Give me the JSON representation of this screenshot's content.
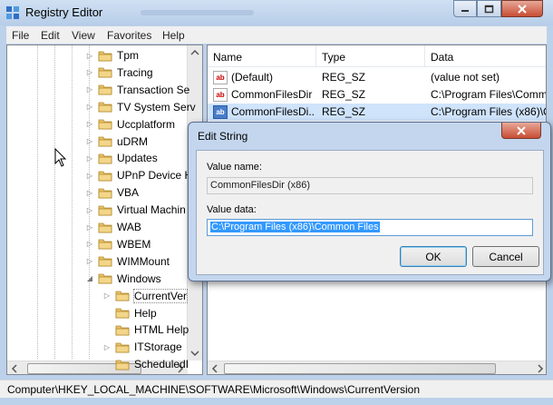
{
  "window": {
    "title": "Registry Editor",
    "controls": {
      "minimize": "minimize",
      "maximize": "maximize",
      "close": "close"
    }
  },
  "menu": [
    "File",
    "Edit",
    "View",
    "Favorites",
    "Help"
  ],
  "tree": {
    "items": [
      {
        "label": "Tpm",
        "expandable": true
      },
      {
        "label": "Tracing",
        "expandable": true
      },
      {
        "label": "Transaction Se",
        "expandable": true
      },
      {
        "label": "TV System Serv",
        "expandable": true
      },
      {
        "label": "Uccplatform",
        "expandable": true
      },
      {
        "label": "uDRM",
        "expandable": true
      },
      {
        "label": "Updates",
        "expandable": true
      },
      {
        "label": "UPnP Device H",
        "expandable": true
      },
      {
        "label": "VBA",
        "expandable": true
      },
      {
        "label": "Virtual Machin",
        "expandable": true
      },
      {
        "label": "WAB",
        "expandable": true
      },
      {
        "label": "WBEM",
        "expandable": true
      },
      {
        "label": "WIMMount",
        "expandable": true
      },
      {
        "label": "Windows",
        "expandable": true,
        "expanded": true
      },
      {
        "label": "CurrentVer",
        "expandable": true,
        "selected": true,
        "child": true
      },
      {
        "label": "Help",
        "expandable": false,
        "child": true
      },
      {
        "label": "HTML Help",
        "expandable": false,
        "child": true
      },
      {
        "label": "ITStorage",
        "expandable": true,
        "child": true
      },
      {
        "label": "ScheduledI",
        "expandable": false,
        "child": true
      }
    ]
  },
  "list": {
    "columns": [
      "Name",
      "Type",
      "Data"
    ],
    "rows": [
      {
        "icon": "string-value-icon",
        "name": "(Default)",
        "type": "REG_SZ",
        "data": "(value not set)"
      },
      {
        "icon": "string-value-icon",
        "name": "CommonFilesDir",
        "type": "REG_SZ",
        "data": "C:\\Program Files\\Comm"
      },
      {
        "icon": "string-value-icon",
        "name": "CommonFilesDi...",
        "type": "REG_SZ",
        "data": "C:\\Program Files (x86)\\C",
        "selected": true
      }
    ]
  },
  "status": {
    "path": "Computer\\HKEY_LOCAL_MACHINE\\SOFTWARE\\Microsoft\\Windows\\CurrentVersion"
  },
  "dialog": {
    "title": "Edit String",
    "value_name_label": "Value name:",
    "value_name": "CommonFilesDir (x86)",
    "value_data_label": "Value data:",
    "value_data": "C:\\Program Files (x86)\\Common Files",
    "ok_label": "OK",
    "cancel_label": "Cancel"
  },
  "colors": {
    "accent": "#3399ff",
    "title_bar": "#bcd1ea",
    "close_button": "#c74d33"
  }
}
